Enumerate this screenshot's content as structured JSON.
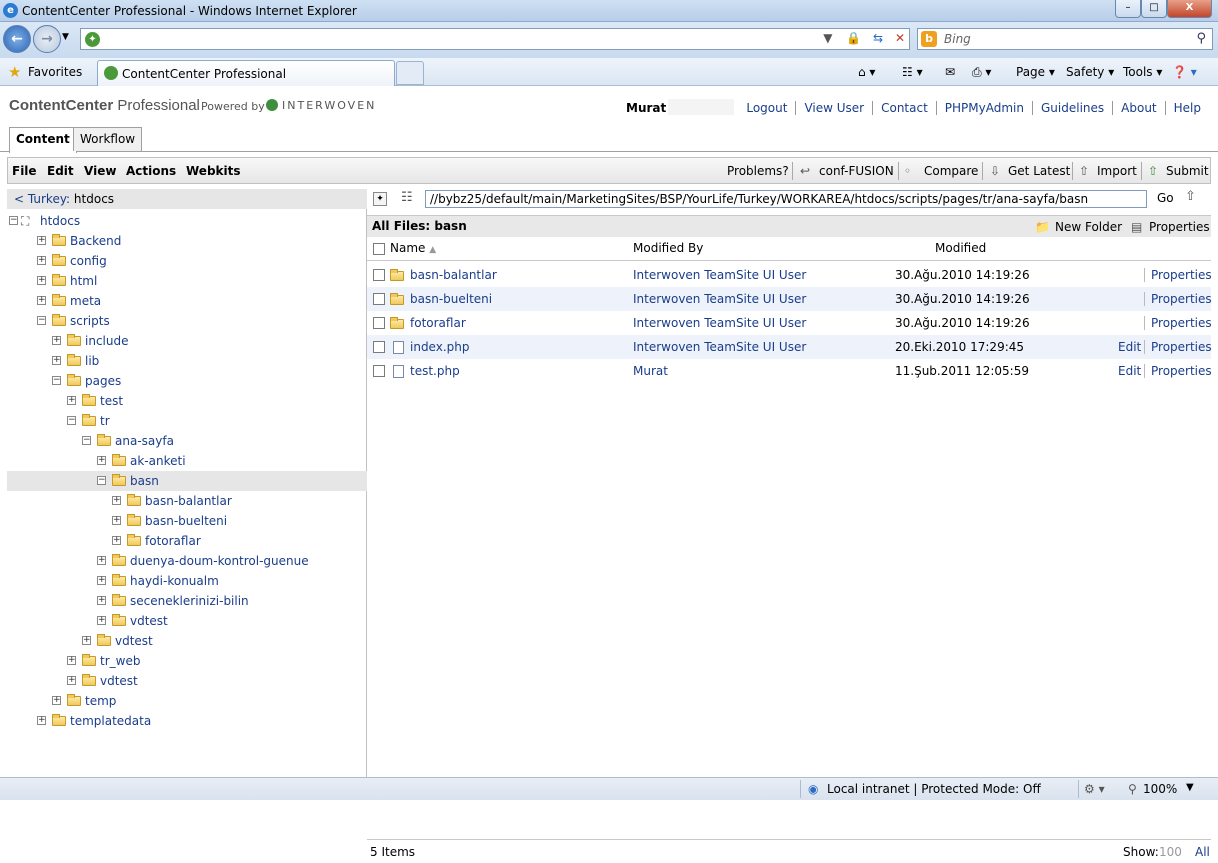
{
  "window": {
    "title": "ContentCenter Professional - Windows Internet Explorer"
  },
  "browser": {
    "search_placeholder": "Bing",
    "favorites_label": "Favorites",
    "tab_title": "ContentCenter Professional",
    "commands": {
      "page": "Page",
      "safety": "Safety",
      "tools": "Tools"
    }
  },
  "app": {
    "logo": {
      "name": "ContentCenter",
      "suffix": " Professional"
    },
    "powered_by": "Powered by",
    "vendor": "INTERWOVEN",
    "user": "Murat",
    "top_links": [
      "Logout",
      "View User",
      "Contact",
      "PHPMyAdmin",
      "Guidelines",
      "About",
      "Help"
    ],
    "tabs": [
      "Content",
      "Workflow"
    ],
    "menu": [
      "File",
      "Edit",
      "View",
      "Actions",
      "Webkits"
    ],
    "toolbar": {
      "problems": "Problems?",
      "conf_fusion": "conf-FUSION",
      "compare": "Compare",
      "get_latest": "Get Latest",
      "import": "Import",
      "submit": "Submit"
    }
  },
  "left_panel": {
    "back_label": "< Turkey:",
    "current": "htdocs",
    "tree": [
      {
        "label": "htdocs",
        "depth": 0,
        "expanded": true,
        "root": true
      },
      {
        "label": "Backend",
        "depth": 1,
        "expanded": false
      },
      {
        "label": "config",
        "depth": 1,
        "expanded": false
      },
      {
        "label": "html",
        "depth": 1,
        "expanded": false
      },
      {
        "label": "meta",
        "depth": 1,
        "expanded": false
      },
      {
        "label": "scripts",
        "depth": 1,
        "expanded": true
      },
      {
        "label": "include",
        "depth": 2,
        "expanded": false
      },
      {
        "label": "lib",
        "depth": 2,
        "expanded": false
      },
      {
        "label": "pages",
        "depth": 2,
        "expanded": true
      },
      {
        "label": "test",
        "depth": 3,
        "expanded": false
      },
      {
        "label": "tr",
        "depth": 3,
        "expanded": true
      },
      {
        "label": "ana-sayfa",
        "depth": 4,
        "expanded": true
      },
      {
        "label": "ak-anketi",
        "depth": 5,
        "expanded": false
      },
      {
        "label": "basn",
        "depth": 5,
        "expanded": true,
        "selected": true
      },
      {
        "label": "basn-balantlar",
        "depth": 6,
        "expanded": false
      },
      {
        "label": "basn-buelteni",
        "depth": 6,
        "expanded": false
      },
      {
        "label": "fotoraflar",
        "depth": 6,
        "expanded": false
      },
      {
        "label": "duenya-doum-kontrol-guenue",
        "depth": 5,
        "expanded": false
      },
      {
        "label": "haydi-konualm",
        "depth": 5,
        "expanded": false
      },
      {
        "label": "seceneklerinizi-bilin",
        "depth": 5,
        "expanded": false
      },
      {
        "label": "vdtest",
        "depth": 5,
        "expanded": false
      },
      {
        "label": "vdtest",
        "depth": 4,
        "expanded": false
      },
      {
        "label": "tr_web",
        "depth": 3,
        "expanded": false
      },
      {
        "label": "vdtest",
        "depth": 3,
        "expanded": false
      },
      {
        "label": "temp",
        "depth": 2,
        "expanded": false
      },
      {
        "label": "templatedata",
        "depth": 1,
        "expanded": false
      }
    ]
  },
  "right_panel": {
    "path": "//bybz25/default/main/MarketingSites/BSP/YourLife/Turkey/WORKAREA/htdocs/scripts/pages/tr/ana-sayfa/basn",
    "go_label": "Go",
    "header": "All Files: basn",
    "new_folder": "New Folder",
    "properties": "Properties",
    "columns": {
      "name": "Name",
      "modified_by": "Modified By",
      "modified": "Modified"
    },
    "files": [
      {
        "name": "basn-balantlar",
        "type": "folder",
        "modified_by": "Interwoven TeamSite UI User",
        "modified": "30.Ağu.2010 14:19:26",
        "edit": "",
        "props": "Properties"
      },
      {
        "name": "basn-buelteni",
        "type": "folder",
        "modified_by": "Interwoven TeamSite UI User",
        "modified": "30.Ağu.2010 14:19:26",
        "edit": "",
        "props": "Properties"
      },
      {
        "name": "fotoraflar",
        "type": "folder",
        "modified_by": "Interwoven TeamSite UI User",
        "modified": "30.Ağu.2010 14:19:26",
        "edit": "",
        "props": "Properties"
      },
      {
        "name": "index.php",
        "type": "file",
        "modified_by": "Interwoven TeamSite UI User",
        "modified": "20.Eki.2010 17:29:45",
        "edit": "Edit",
        "props": "Properties"
      },
      {
        "name": "test.php",
        "type": "file-edited",
        "modified_by": "Murat",
        "modified": "11.Şub.2011 12:05:59",
        "edit": "Edit",
        "props": "Properties"
      }
    ],
    "footer": {
      "count": "5 Items",
      "show_label": "Show:",
      "show_100": "100",
      "show_all": "All"
    }
  },
  "statusbar": {
    "zone": "Local intranet | Protected Mode: Off",
    "zoom": "100%"
  }
}
